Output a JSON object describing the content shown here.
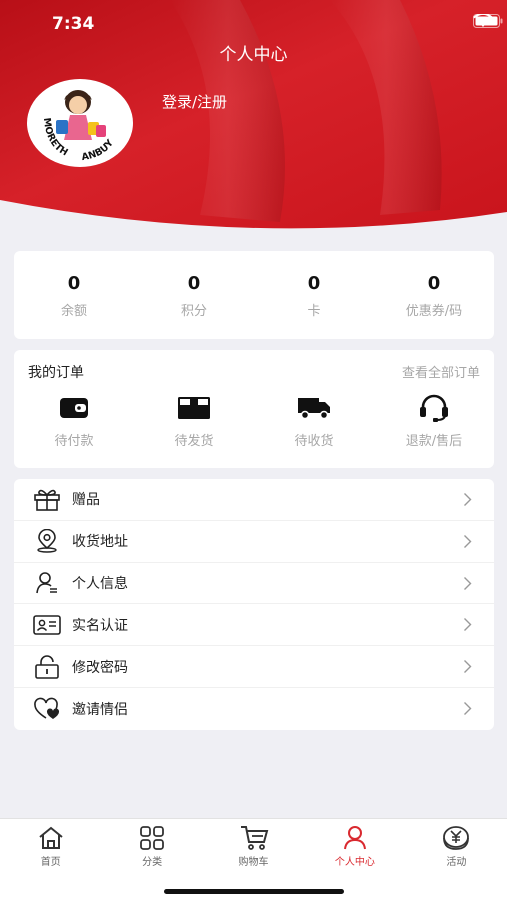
{
  "status": {
    "time": "7:34"
  },
  "header": {
    "title": "个人中心",
    "login_label": "登录/注册",
    "avatar_logo_text": "MORETHANBUY"
  },
  "stats": [
    {
      "value": "0",
      "label": "余额"
    },
    {
      "value": "0",
      "label": "积分"
    },
    {
      "value": "0",
      "label": "卡"
    },
    {
      "value": "0",
      "label": "优惠券/码"
    }
  ],
  "orders": {
    "title": "我的订单",
    "view_all": "查看全部订单",
    "items": [
      {
        "label": "待付款",
        "icon": "wallet-icon"
      },
      {
        "label": "待发货",
        "icon": "box-icon"
      },
      {
        "label": "待收货",
        "icon": "truck-icon"
      },
      {
        "label": "退款/售后",
        "icon": "headset-icon"
      }
    ]
  },
  "menu": [
    {
      "label": "赠品",
      "icon": "gift-icon"
    },
    {
      "label": "收货地址",
      "icon": "location-icon"
    },
    {
      "label": "个人信息",
      "icon": "user-icon"
    },
    {
      "label": "实名认证",
      "icon": "id-card-icon"
    },
    {
      "label": "修改密码",
      "icon": "lock-icon"
    },
    {
      "label": "邀请情侣",
      "icon": "heart-icon"
    }
  ],
  "tabbar": [
    {
      "label": "首页",
      "icon": "home-icon",
      "active": false
    },
    {
      "label": "分类",
      "icon": "grid-icon",
      "active": false
    },
    {
      "label": "购物车",
      "icon": "cart-icon",
      "active": false
    },
    {
      "label": "个人中心",
      "icon": "profile-icon",
      "active": true
    },
    {
      "label": "活动",
      "icon": "coins-icon",
      "active": false
    }
  ],
  "colors": {
    "accent": "#d9292f",
    "header_red": "#c8161e",
    "background": "#efeff4"
  }
}
